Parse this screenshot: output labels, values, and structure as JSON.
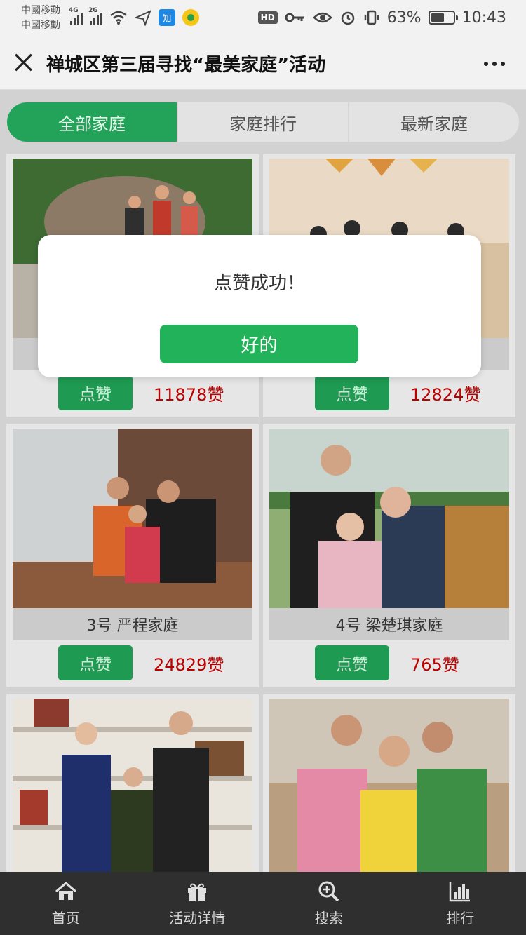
{
  "status_bar": {
    "carrier_1": "中國移動",
    "carrier_2": "中國移動",
    "net_1": "4G",
    "net_2": "2G",
    "app_zhi": "知",
    "hd": "HD",
    "battery": "63%",
    "battery_level": 0.63,
    "time": "10:43"
  },
  "header": {
    "title": "禅城区第三届寻找“最美家庭”活动"
  },
  "tabs": [
    {
      "label": "全部家庭",
      "active": true
    },
    {
      "label": "家庭排行",
      "active": false
    },
    {
      "label": "最新家庭",
      "active": false
    }
  ],
  "cards": [
    {
      "caption": "",
      "like_label": "点赞",
      "likes": "11878赞"
    },
    {
      "caption": "",
      "like_label": "点赞",
      "likes": "12824赞"
    },
    {
      "caption": "3号 严程家庭",
      "like_label": "点赞",
      "likes": "24829赞"
    },
    {
      "caption": "4号 梁楚琪家庭",
      "like_label": "点赞",
      "likes": "765赞"
    },
    {
      "caption": "",
      "like_label": "",
      "likes": ""
    },
    {
      "caption": "",
      "like_label": "",
      "likes": ""
    }
  ],
  "dialog": {
    "message": "点赞成功！",
    "ok_label": "好的"
  },
  "bottom_nav": [
    {
      "label": "首页",
      "icon": "home-icon"
    },
    {
      "label": "活动详情",
      "icon": "gift-icon"
    },
    {
      "label": "搜索",
      "icon": "search-icon"
    },
    {
      "label": "排行",
      "icon": "bar-chart-icon"
    }
  ],
  "colors": {
    "accent": "#22a359",
    "likes": "#bb0000",
    "nav_bg": "#2f2f2f"
  }
}
